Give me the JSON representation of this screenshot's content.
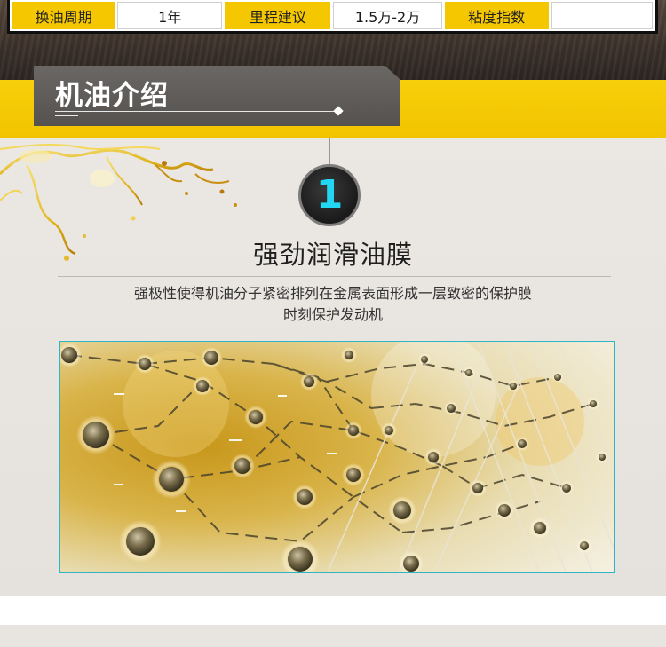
{
  "spec_table": {
    "cells": [
      {
        "label": "换油周期",
        "kind": "key"
      },
      {
        "label": "1年",
        "kind": "value"
      },
      {
        "label": "里程建议",
        "kind": "key"
      },
      {
        "label": "1.5万-2万",
        "kind": "value"
      },
      {
        "label": "粘度指数",
        "kind": "key"
      },
      {
        "label": "",
        "kind": "value"
      }
    ]
  },
  "section": {
    "title": "机油介绍"
  },
  "feature": {
    "number": "1",
    "title": "强劲润滑油膜",
    "desc_line1": "强极性使得机油分子紧密排列在金属表面形成一层致密的保护膜",
    "desc_line2": "时刻保护发动机"
  },
  "colors": {
    "accent_yellow": "#f2c400",
    "badge_number": "#22d7f2",
    "plate_grey": "#5e5b59",
    "image_border": "#2fb5c4"
  }
}
